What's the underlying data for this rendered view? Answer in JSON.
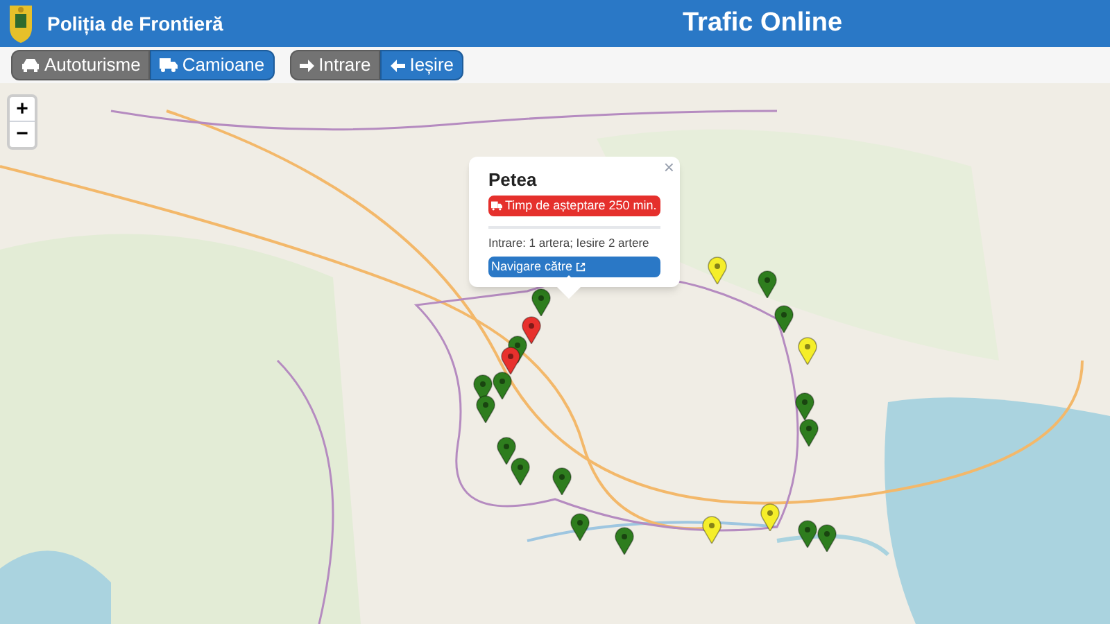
{
  "header": {
    "brand": "Poliția de Frontieră",
    "title": "Trafic Online"
  },
  "vehicle_tabs": [
    {
      "label": "Autoturisme",
      "kind": "car",
      "selected": false
    },
    {
      "label": "Camioane",
      "kind": "truck",
      "selected": true
    }
  ],
  "direction_tabs": [
    {
      "label": "Intrare",
      "kind": "entry",
      "selected": false
    },
    {
      "label": "Ieșire",
      "kind": "exit",
      "selected": true
    }
  ],
  "zoom": {
    "in": "+",
    "out": "−"
  },
  "popup": {
    "title": "Petea",
    "close": "×",
    "wait": "Timp de așteptare 250 min.",
    "lanes": "Intrare: 1 artera; Iesire 2 artere",
    "navigate": "Navigare către"
  },
  "markers": [
    {
      "color": "#2e7d1e"
    },
    {
      "color": "#2e7d1e"
    },
    {
      "color": "#2e7d1e"
    },
    {
      "color": "#2e7d1e"
    },
    {
      "color": "#2e7d1e"
    },
    {
      "color": "#2e7d1e"
    },
    {
      "color": "#2e7d1e"
    },
    {
      "color": "#2e7d1e"
    },
    {
      "color": "#2e7d1e"
    },
    {
      "color": "#2e7d1e"
    },
    {
      "color": "#2e7d1e"
    },
    {
      "color": "#2e7d1e"
    },
    {
      "color": "#2e7d1e"
    },
    {
      "color": "#2e7d1e"
    },
    {
      "color": "#2e7d1e"
    },
    {
      "color": "#2e7d1e"
    },
    {
      "color": "#e8312d"
    },
    {
      "color": "#e8312d"
    },
    {
      "color": "#f5ee2a"
    },
    {
      "color": "#f5ee2a"
    },
    {
      "color": "#f5ee2a"
    },
    {
      "color": "#f5ee2a"
    }
  ]
}
